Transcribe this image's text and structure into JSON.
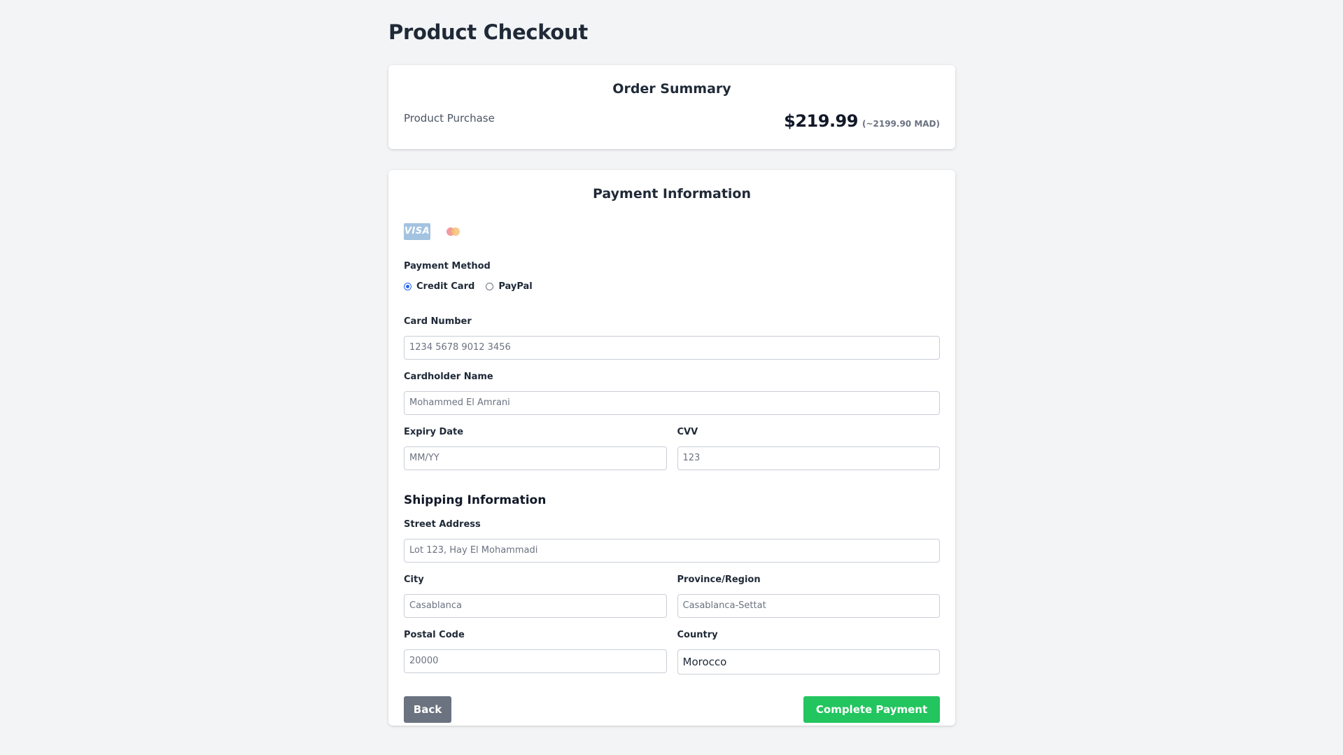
{
  "page": {
    "title": "Product Checkout"
  },
  "order_summary": {
    "title": "Order Summary",
    "product_label": "Product Purchase",
    "price": "$219.99",
    "price_mad": "(~2199.90 MAD)"
  },
  "payment": {
    "title": "Payment Information",
    "card_icons": [
      "visa-icon",
      "mastercard-icon"
    ],
    "visa_text": "VISA",
    "method_label": "Payment Method",
    "methods": [
      {
        "label": "Credit Card",
        "selected": true
      },
      {
        "label": "PayPal",
        "selected": false
      }
    ],
    "card_number": {
      "label": "Card Number",
      "placeholder": "1234 5678 9012 3456"
    },
    "cardholder": {
      "label": "Cardholder Name",
      "placeholder": "Mohammed El Amrani"
    },
    "expiry": {
      "label": "Expiry Date",
      "placeholder": "MM/YY"
    },
    "cvv": {
      "label": "CVV",
      "placeholder": "123"
    }
  },
  "shipping": {
    "title": "Shipping Information",
    "street": {
      "label": "Street Address",
      "placeholder": "Lot 123, Hay El Mohammadi"
    },
    "city": {
      "label": "City",
      "placeholder": "Casablanca"
    },
    "province": {
      "label": "Province/Region",
      "placeholder": "Casablanca-Settat"
    },
    "postal": {
      "label": "Postal Code",
      "placeholder": "20000"
    },
    "country": {
      "label": "Country",
      "value": "Morocco"
    }
  },
  "actions": {
    "back_label": "Back",
    "pay_label": "Complete Payment"
  },
  "colors": {
    "background": "#f3f4f6",
    "pay_button": "#22c55e",
    "back_button": "#6b7280",
    "radio_selected": "#2563eb"
  }
}
